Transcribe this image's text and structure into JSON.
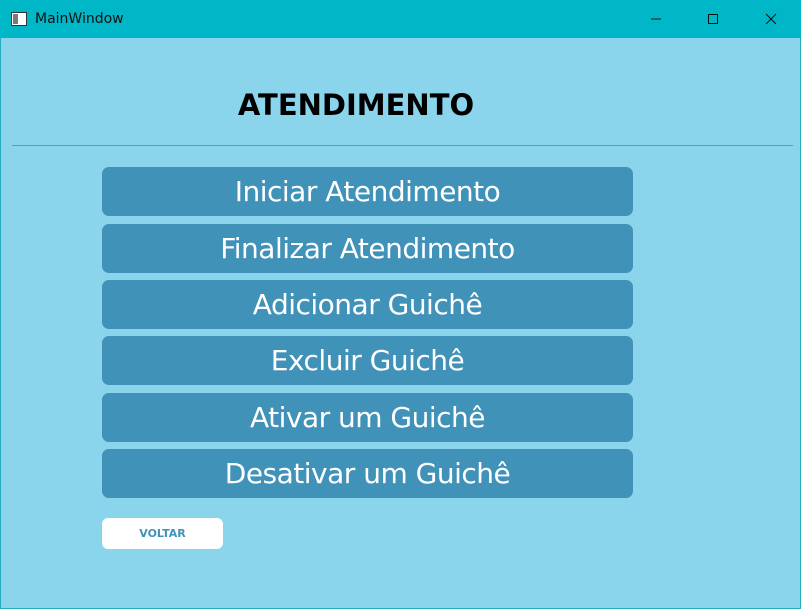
{
  "window": {
    "title": "MainWindow",
    "icons": {
      "app": "window-icon",
      "minimize": "minimize-icon",
      "maximize": "maximize-icon",
      "close": "close-icon"
    },
    "colors": {
      "titlebar": "#00b7c8",
      "background": "#8ad4ec"
    }
  },
  "main": {
    "heading": "ATENDIMENTO",
    "buttons": [
      {
        "label": "Iniciar Atendimento"
      },
      {
        "label": "Finalizar Atendimento"
      },
      {
        "label": "Adicionar Guichê"
      },
      {
        "label": "Excluir Guichê"
      },
      {
        "label": "Ativar um Guichê"
      },
      {
        "label": "Desativar um Guichê"
      }
    ],
    "back_label": "VOLTAR",
    "colors": {
      "button_bg": "#4092b8",
      "button_text": "#ffffff",
      "back_bg": "#ffffff",
      "back_text": "#4092b8"
    }
  }
}
